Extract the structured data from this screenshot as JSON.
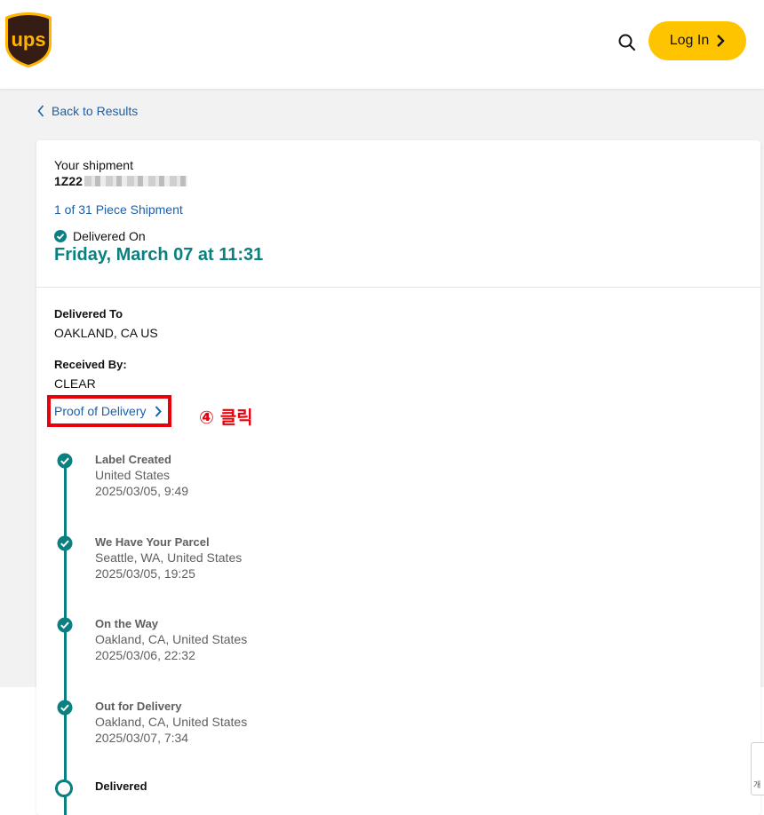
{
  "header": {
    "logo_text": "ups",
    "login_label": "Log In",
    "search_icon": "search-icon"
  },
  "nav": {
    "back_label": "Back to Results"
  },
  "shipment": {
    "heading": "Your shipment",
    "tracking_prefix": "1Z22",
    "piece_link": "1 of 31 Piece Shipment",
    "status_label": "Delivered On",
    "delivered_date": "Friday, March 07 at 11:31"
  },
  "details": {
    "delivered_to_label": "Delivered To",
    "delivered_to_value": "OAKLAND, CA US",
    "received_by_label": "Received By:",
    "received_by_value": "CLEAR",
    "pod_link": "Proof of Delivery"
  },
  "annotation": {
    "text": "④ 클릭",
    "color": "#e8000b"
  },
  "timeline": [
    {
      "title": "Label Created",
      "location": "United States",
      "time": "2025/03/05, 9:49"
    },
    {
      "title": "We Have Your Parcel",
      "location": "Seattle, WA, United States",
      "time": "2025/03/05, 19:25"
    },
    {
      "title": "On the Way",
      "location": "Oakland, CA, United States",
      "time": "2025/03/06, 22:32"
    },
    {
      "title": "Out for Delivery",
      "location": "Oakland, CA, United States",
      "time": "2025/03/07, 7:34"
    },
    {
      "title": "Delivered"
    }
  ],
  "corner_widget": {
    "text": "개"
  },
  "colors": {
    "brand_brown": "#351c15",
    "brand_gold": "#ffb500",
    "button_yellow": "#ffc400",
    "link_blue": "#1d5fa8",
    "teal": "#0a8080"
  }
}
